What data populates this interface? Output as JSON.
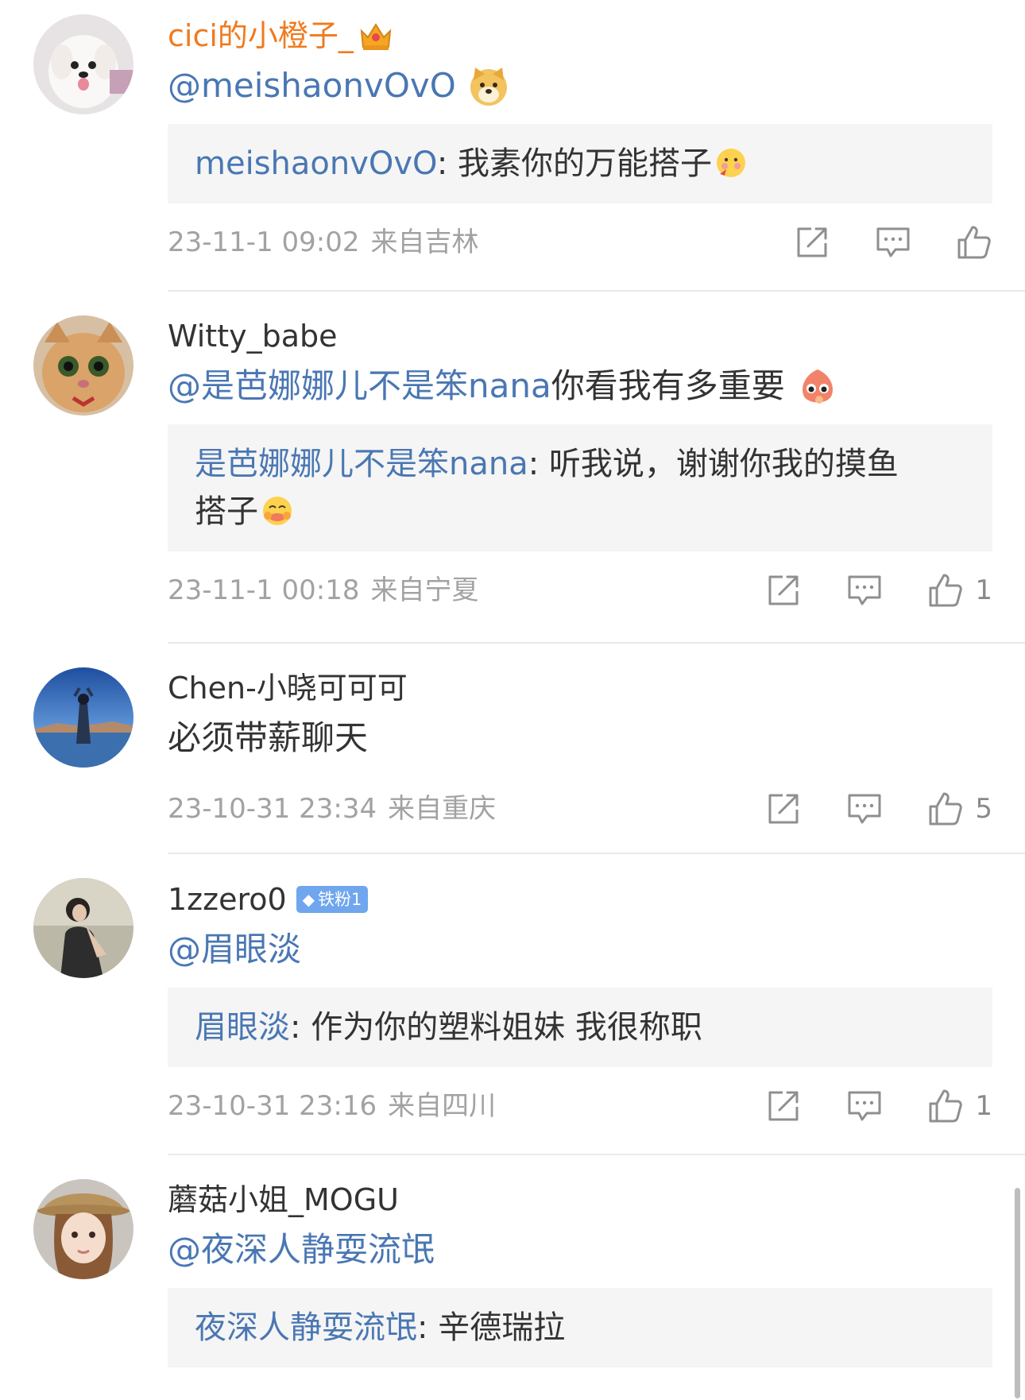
{
  "comments": [
    {
      "username": "cici的小橙子_",
      "username_color": "#f17a1e",
      "badge_icon": "crown-icon",
      "mention": "@meishaonvOvO",
      "text": "",
      "text_emoji": "doge-icon",
      "quote_name": "meishaonvOvO",
      "quote_text": ": 我素你的万能搭子",
      "quote_emoji": "shy-blush-icon",
      "date": "23-11-1 09:02",
      "location": "来自吉林",
      "likes": ""
    },
    {
      "username": "Witty_babe",
      "mention": "@是芭娜娜儿不是笨nana",
      "text": " 你看我有多重要",
      "text_emoji": "peach-cute-icon",
      "quote_name": "是芭娜娜儿不是笨nana",
      "quote_text": ": 听我说，谢谢你我的摸鱼",
      "quote_text_line2": "搭子",
      "quote_emoji": "hug-icon",
      "date": "23-11-1 00:18",
      "location": "来自宁夏",
      "likes": "1"
    },
    {
      "username": "Chen-小晓可可可",
      "text": "必须带薪聊天",
      "date": "23-10-31 23:34",
      "location": "来自重庆",
      "likes": "5"
    },
    {
      "username": "1zzero0",
      "fan_badge": "铁粉1",
      "mention": "@眉眼淡",
      "quote_name": "眉眼淡",
      "quote_text": ": 作为你的塑料姐妹 我很称职",
      "date": "23-10-31 23:16",
      "location": "来自四川",
      "likes": "1"
    },
    {
      "username": "蘑菇小姐_MOGU",
      "mention": "@夜深人静耍流氓",
      "quote_name": "夜深人静耍流氓",
      "quote_text": ": 辛德瑞拉"
    }
  ],
  "colors": {
    "link": "#4a77b3",
    "meta": "#a2a2a2",
    "quote_bg": "#f5f5f5",
    "icon": "#8f8f8f",
    "fan_badge": "#6fa6ee"
  },
  "icons": {
    "repost": "share-icon",
    "comment": "comment-icon",
    "like": "thumbs-up-icon"
  }
}
